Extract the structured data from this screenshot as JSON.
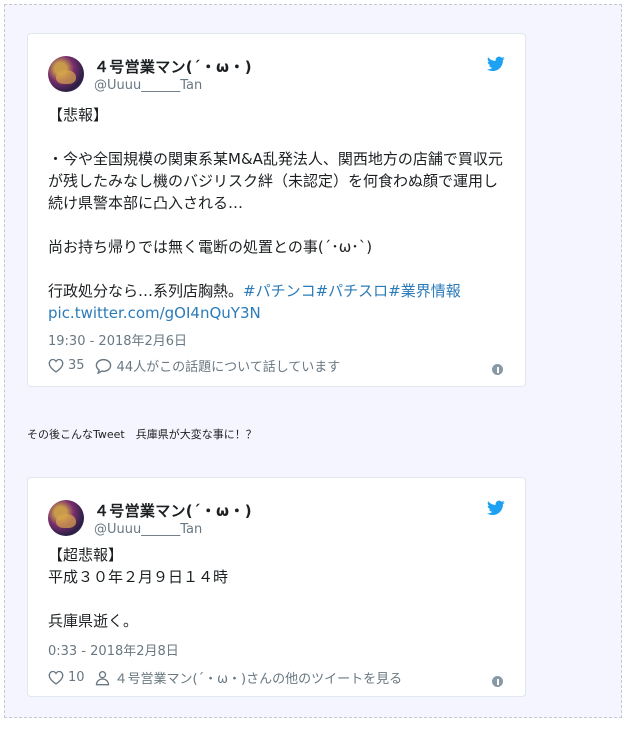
{
  "tweets": [
    {
      "author_name": "４号営業マン(´・ω・)",
      "handle": "@Uuuu______Tan",
      "body_main": "【悲報】\n\n・今や全国規模の関東系某M&A乱発法人、関西地方の店舗で買収元が残したみなし機のバジリスク絆（未認定）を何食わぬ顔で運用し続け県警本部に凸入される…\n\n尚お持ち帰りでは無く電断の処置との事(´･ω･`)\n\n行政処分なら…系列店胸熱。",
      "body_links": "#パチンコ#パチスロ#業界情報 pic.twitter.com/gOI4nQuY3N",
      "date": "19:30 - 2018年2月6日",
      "likes": "35",
      "action_text": "44人がこの話題について話しています"
    },
    {
      "author_name": "４号営業マン(´・ω・)",
      "handle": "@Uuuu______Tan",
      "body_main": "【超悲報】\n平成３０年２月９日１４時\n\n兵庫県逝く。",
      "date": "0:33 - 2018年2月8日",
      "likes": "10",
      "action_text": "４号営業マン(´・ω・)さんの他のツイートを見る"
    }
  ],
  "caption": "その後こんなTweet　兵庫県が大変な事に！？",
  "colors": {
    "twitter_blue": "#1da1f2",
    "link": "#2b7bb9",
    "meta": "#697882"
  },
  "icons": [
    "twitter-bird-icon",
    "heart-icon",
    "comment-icon",
    "person-icon",
    "info-icon"
  ]
}
